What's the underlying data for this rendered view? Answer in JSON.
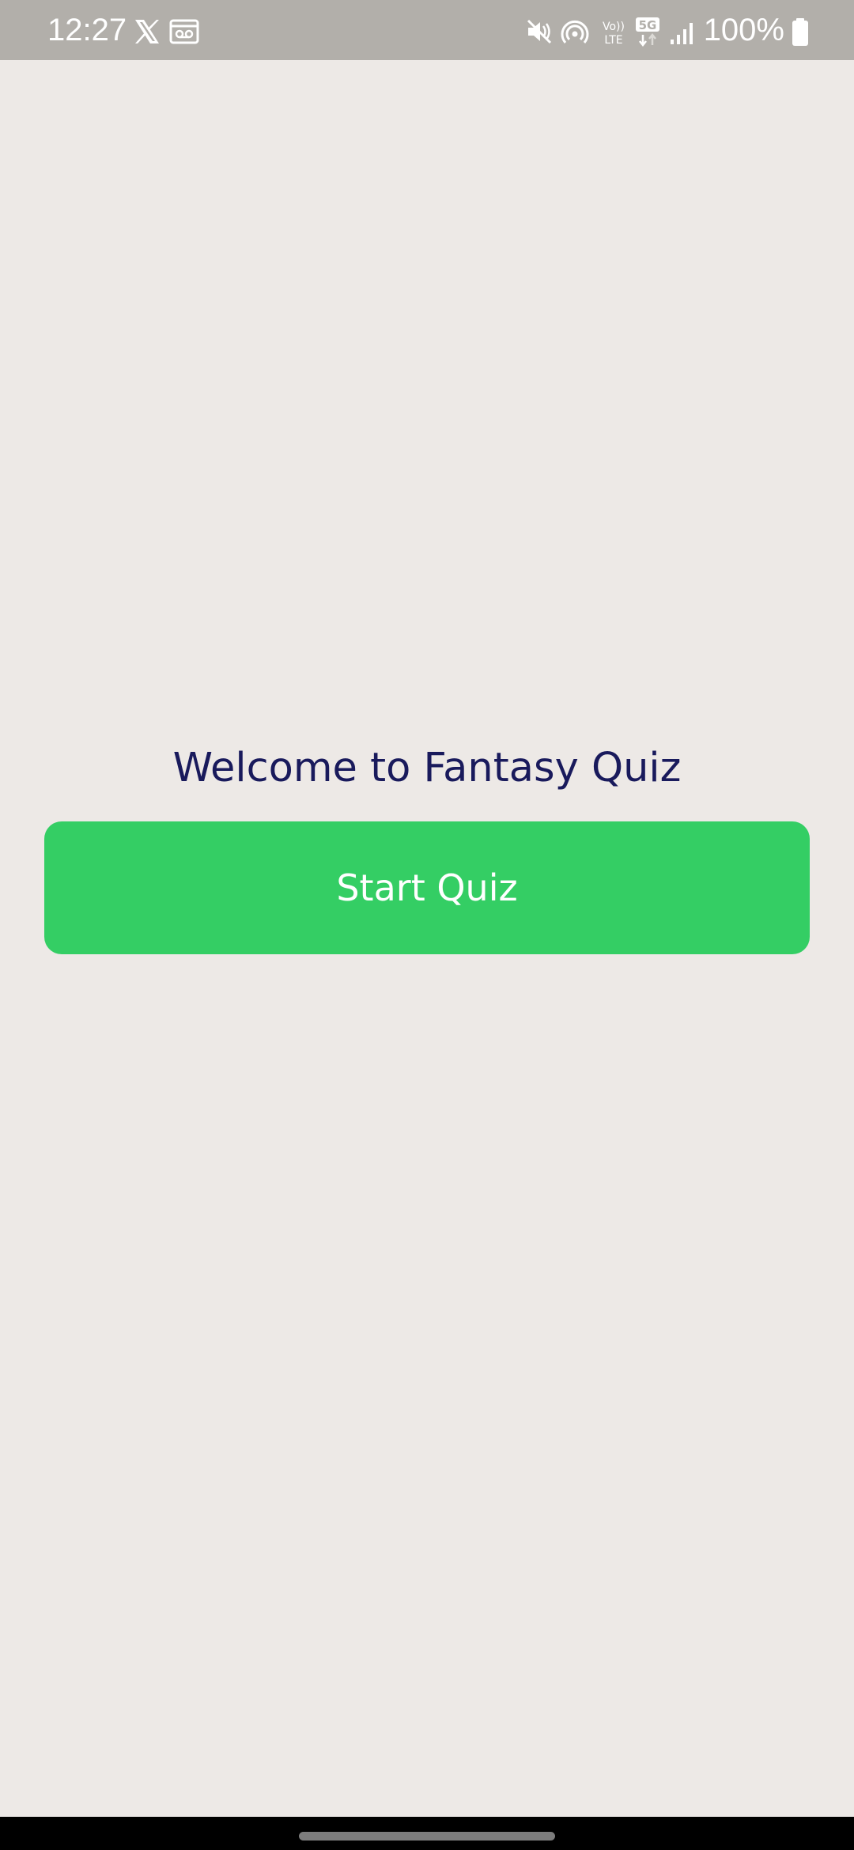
{
  "status_bar": {
    "time": "12:27",
    "battery": "100%",
    "icons": [
      "x-logo-icon",
      "voicemail-icon",
      "mute-icon",
      "hotspot-icon",
      "volte-icon",
      "5g-icon",
      "signal-icon",
      "battery-icon"
    ]
  },
  "screen": {
    "welcome_text": "Welcome to Fantasy Quiz",
    "start_button_label": "Start Quiz"
  },
  "colors": {
    "background": "#ede9e6",
    "status_bar": "#b2afaa",
    "title": "#191a5c",
    "button": "#34ce64",
    "button_text": "#ffffff"
  }
}
